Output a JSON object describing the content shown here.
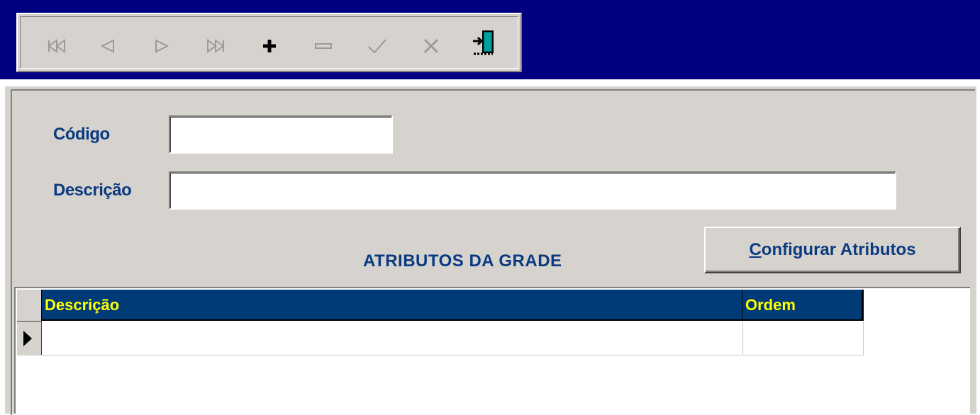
{
  "toolbar": {
    "buttons": [
      {
        "name": "first-record-icon"
      },
      {
        "name": "prior-record-icon"
      },
      {
        "name": "next-record-icon"
      },
      {
        "name": "last-record-icon"
      },
      {
        "name": "insert-record-icon"
      },
      {
        "name": "delete-record-icon"
      },
      {
        "name": "post-edit-icon"
      },
      {
        "name": "cancel-edit-icon"
      },
      {
        "name": "exit-door-icon"
      }
    ]
  },
  "form": {
    "codigo_label": "Código",
    "codigo_value": "",
    "descricao_label": "Descrição",
    "descricao_value": "",
    "section_title": "ATRIBUTOS DA GRADE",
    "config_button_hotkey": "C",
    "config_button_rest": "onfigurar Atributos"
  },
  "grid": {
    "columns": [
      "Descrição",
      "Ordem"
    ],
    "rows": [
      {
        "descricao": "",
        "ordem": ""
      }
    ]
  },
  "colors": {
    "title_bar": "#000080",
    "panel": "#d6d3ce",
    "label_text": "#0b3a80",
    "grid_header_bg": "#003b78",
    "grid_header_text": "#ffff00"
  }
}
